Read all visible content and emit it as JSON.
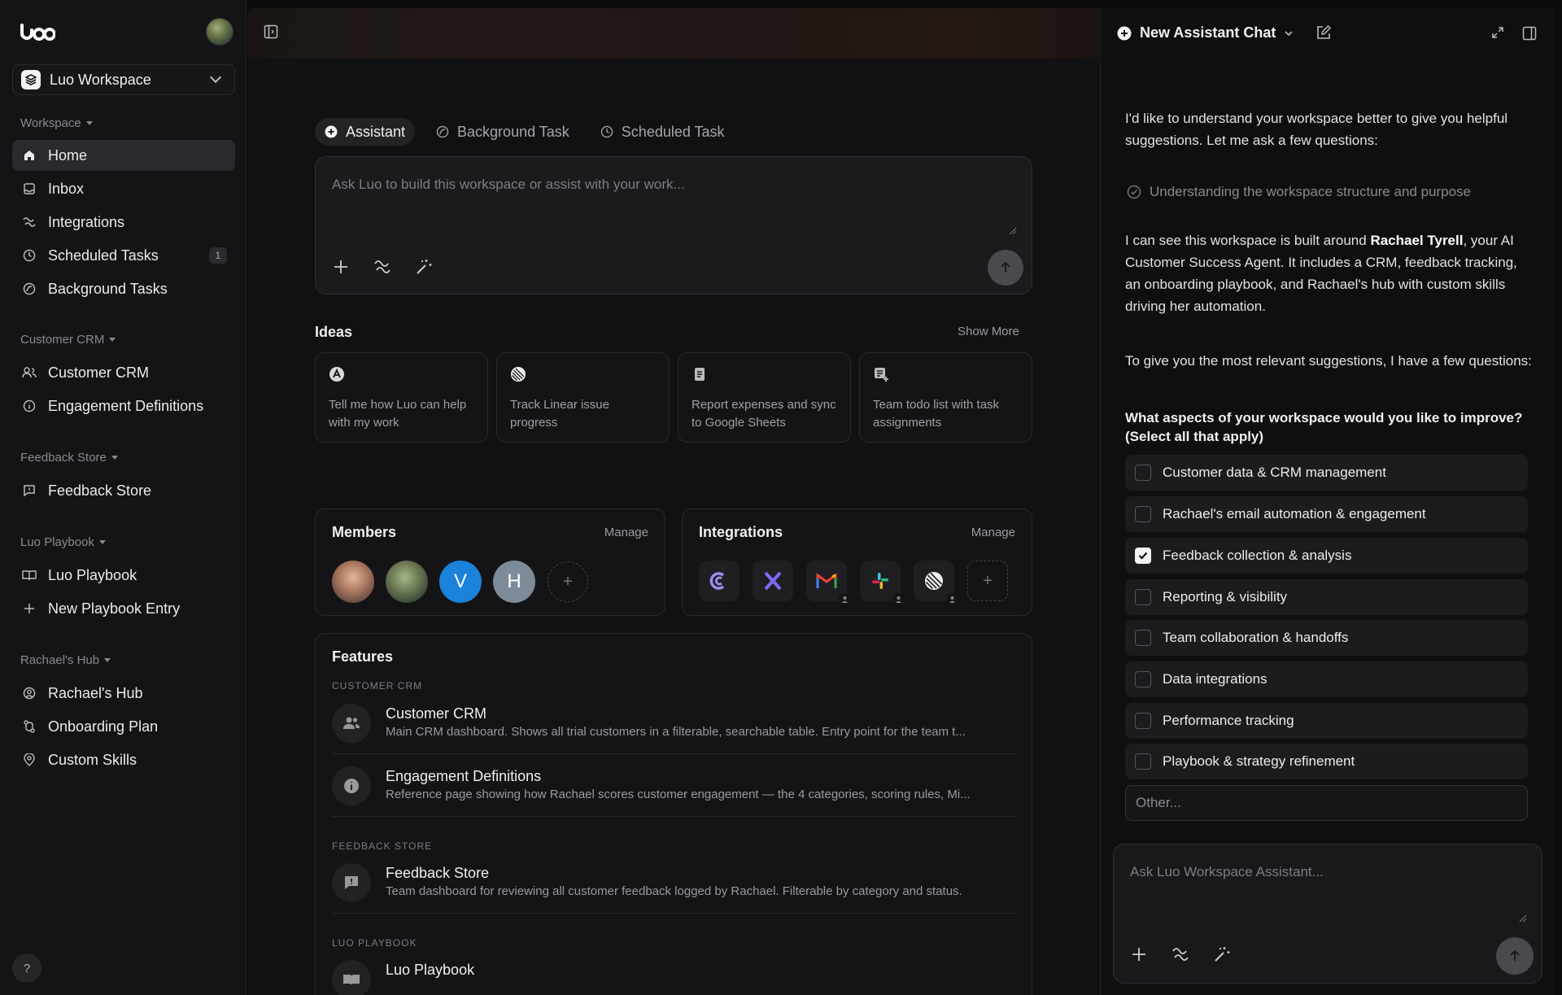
{
  "sidebar": {
    "workspace_name": "Luo Workspace",
    "sections": [
      {
        "label": "Workspace"
      },
      {
        "label": "Customer CRM"
      },
      {
        "label": "Feedback Store"
      },
      {
        "label": "Luo Playbook"
      },
      {
        "label": "Rachael's Hub"
      }
    ],
    "items": {
      "home": "Home",
      "inbox": "Inbox",
      "integrations": "Integrations",
      "scheduled_tasks": "Scheduled Tasks",
      "scheduled_badge": "1",
      "background_tasks": "Background Tasks",
      "customer_crm": "Customer CRM",
      "engagement_definitions": "Engagement Definitions",
      "feedback_store": "Feedback Store",
      "luo_playbook": "Luo Playbook",
      "new_playbook_entry": "New Playbook Entry",
      "rachaels_hub": "Rachael's Hub",
      "onboarding_plan": "Onboarding Plan",
      "custom_skills": "Custom Skills"
    },
    "help": "?"
  },
  "main": {
    "tabs": [
      "Assistant",
      "Background Task",
      "Scheduled Task"
    ],
    "compose_placeholder": "Ask Luo to build this workspace or assist with your work...",
    "ideas": {
      "title": "Ideas",
      "show_more": "Show More",
      "cards": [
        "Tell me how Luo can help with my work",
        "Track Linear issue progress",
        "Report expenses and sync to Google Sheets",
        "Team todo list with task assignments"
      ]
    },
    "members": {
      "title": "Members",
      "manage": "Manage",
      "letters": [
        "V",
        "H"
      ]
    },
    "integrations": {
      "title": "Integrations",
      "manage": "Manage"
    },
    "features": {
      "title": "Features",
      "groups": [
        "CUSTOMER CRM",
        "FEEDBACK STORE",
        "LUO PLAYBOOK"
      ],
      "rows": [
        {
          "title": "Customer CRM",
          "desc": "Main CRM dashboard. Shows all trial customers in a filterable, searchable table. Entry point for the team t..."
        },
        {
          "title": "Engagement Definitions",
          "desc": "Reference page showing how Rachael scores customer engagement — the 4 categories, scoring rules, Mi..."
        },
        {
          "title": "Feedback Store",
          "desc": "Team dashboard for reviewing all customer feedback logged by Rachael. Filterable by category and status."
        },
        {
          "title": "Luo Playbook",
          "desc": ""
        }
      ]
    }
  },
  "panel": {
    "title": "New Assistant Chat",
    "intro": "I'd like to understand your workspace better to give you helpful suggestions. Let me ask a few questions:",
    "step": "Understanding the workspace structure and purpose",
    "para1_a": "I can see this workspace is built around ",
    "para1_name": "Rachael Tyrell",
    "para1_b": ", your AI Customer Success Agent. It includes a CRM, feedback tracking, an onboarding playbook, and Rachael's hub with custom skills driving her automation.",
    "para2": "To give you the most relevant suggestions, I have a few questions:",
    "question": "What aspects of your workspace would you like to improve? (Select all that apply)",
    "options": [
      {
        "label": "Customer data & CRM management",
        "checked": false
      },
      {
        "label": "Rachael's email automation & engagement",
        "checked": false
      },
      {
        "label": "Feedback collection & analysis",
        "checked": true
      },
      {
        "label": "Reporting & visibility",
        "checked": false
      },
      {
        "label": "Team collaboration & handoffs",
        "checked": false
      },
      {
        "label": "Data integrations",
        "checked": false
      },
      {
        "label": "Performance tracking",
        "checked": false
      },
      {
        "label": "Playbook & strategy refinement",
        "checked": false
      }
    ],
    "other_placeholder": "Other...",
    "compose_placeholder": "Ask Luo Workspace Assistant..."
  }
}
